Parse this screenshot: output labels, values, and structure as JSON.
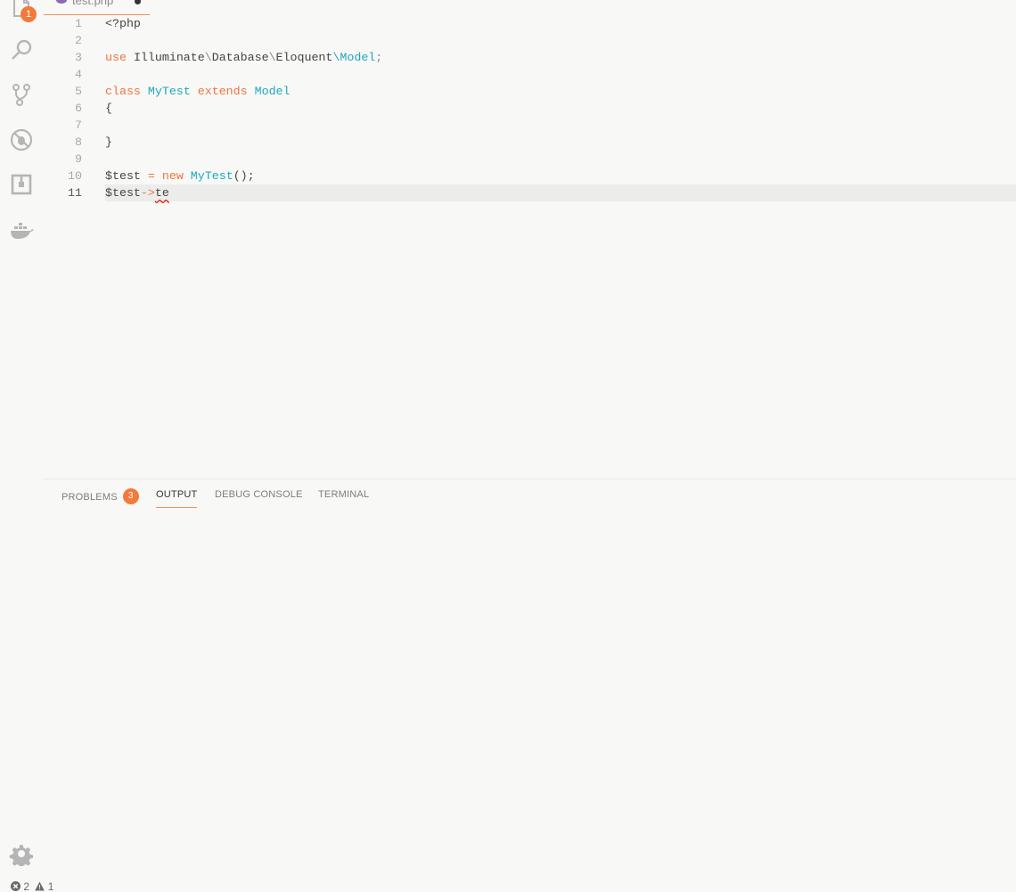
{
  "activity_bar": {
    "explorer_badge": "1",
    "icons": [
      "files-icon",
      "search-icon",
      "source-control-icon",
      "debug-icon",
      "extensions-icon",
      "docker-icon",
      "gear-icon"
    ]
  },
  "tab": {
    "filename": "test.php"
  },
  "editor": {
    "line_numbers": [
      "1",
      "2",
      "3",
      "4",
      "5",
      "6",
      "7",
      "8",
      "9",
      "10",
      "11"
    ],
    "current_line": "11",
    "lines": {
      "l1": "<?php",
      "l3_use": "use",
      "l3_ns1": "Illuminate",
      "l3_sep1": "\\",
      "l3_ns2": "Database",
      "l3_sep2": "\\",
      "l3_ns3": "Eloquent",
      "l3_sep3": "\\",
      "l3_model": "Model",
      "l3_semi": ";",
      "l5_class": "class",
      "l5_name": "MyTest",
      "l5_extends": "extends",
      "l5_parent": "Model",
      "l6": "{",
      "l8": "}",
      "l10_var": "$test",
      "l10_eq": "=",
      "l10_new": "new",
      "l10_cls": "MyTest",
      "l10_rest": "();",
      "l11_var": "$test",
      "l11_arrow": "->",
      "l11_member": "te"
    }
  },
  "panel": {
    "tabs": [
      {
        "label": "PROBLEMS",
        "badge": "3"
      },
      {
        "label": "OUTPUT"
      },
      {
        "label": "DEBUG CONSOLE"
      },
      {
        "label": "TERMINAL"
      }
    ],
    "active_tab": "OUTPUT"
  },
  "status": {
    "errors": "2",
    "warnings": "1"
  },
  "colors": {
    "accent": "#f37a3b",
    "keyword": "#f0753a",
    "type": "#1ba9ba",
    "background": "#f8f8f7"
  }
}
